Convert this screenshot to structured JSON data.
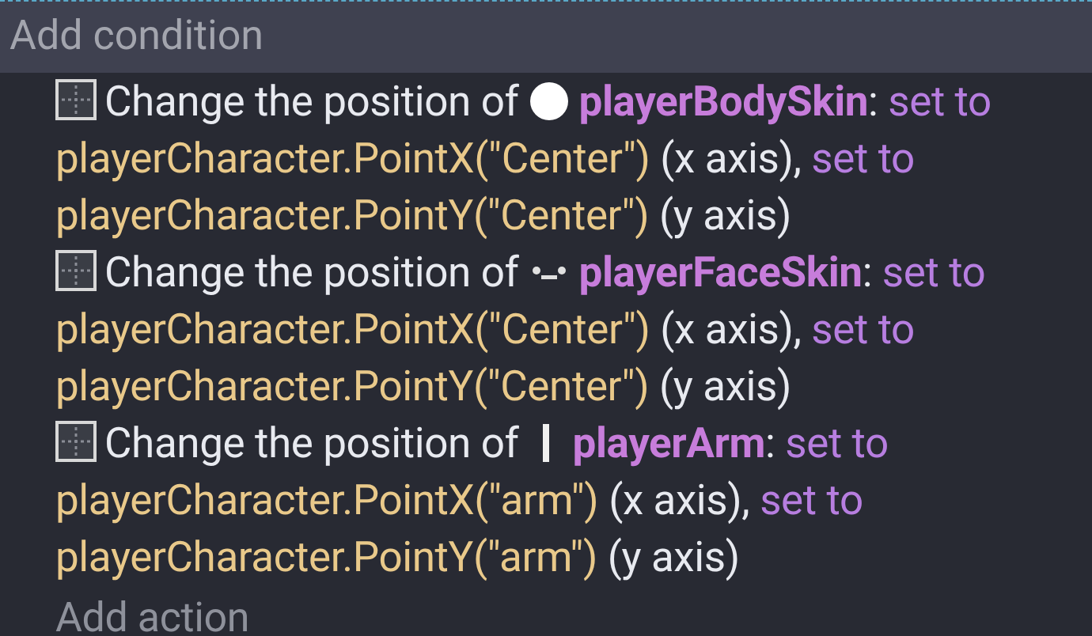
{
  "header": {
    "title": "Add condition"
  },
  "actions": [
    {
      "prefix": "Change the position of",
      "object": {
        "name": "playerBodySkin",
        "kind": "circle"
      },
      "parts": [
        {
          "kind": "punct",
          "text": ":"
        },
        {
          "kind": "keyword",
          "text": "set to"
        },
        {
          "kind": "expr",
          "text": "playerCharacter.PointX(\"Center\")"
        },
        {
          "kind": "text",
          "text": "(x axis),"
        },
        {
          "kind": "keyword",
          "text": "set to"
        },
        {
          "kind": "expr",
          "text": "playerCharacter.PointY(\"Center\")"
        },
        {
          "kind": "text",
          "text": "(y axis)"
        }
      ]
    },
    {
      "prefix": "Change the position of",
      "object": {
        "name": "playerFaceSkin",
        "kind": "face"
      },
      "parts": [
        {
          "kind": "punct",
          "text": ":"
        },
        {
          "kind": "keyword",
          "text": "set to"
        },
        {
          "kind": "expr",
          "text": "playerCharacter.PointX(\"Center\")"
        },
        {
          "kind": "text",
          "text": "(x axis),"
        },
        {
          "kind": "keyword",
          "text": "set to"
        },
        {
          "kind": "expr",
          "text": "playerCharacter.PointY(\"Center\")"
        },
        {
          "kind": "text",
          "text": "(y axis)"
        }
      ]
    },
    {
      "prefix": "Change the position of",
      "object": {
        "name": "playerArm",
        "kind": "bar"
      },
      "parts": [
        {
          "kind": "punct",
          "text": ":"
        },
        {
          "kind": "keyword",
          "text": "set to"
        },
        {
          "kind": "expr",
          "text": "playerCharacter.PointX(\"arm\")"
        },
        {
          "kind": "text",
          "text": "(x axis),"
        },
        {
          "kind": "keyword",
          "text": "set to"
        },
        {
          "kind": "expr",
          "text": "playerCharacter.PointY(\"arm\")"
        },
        {
          "kind": "text",
          "text": "(y axis)"
        }
      ]
    }
  ],
  "footer": {
    "label": "Add action"
  }
}
